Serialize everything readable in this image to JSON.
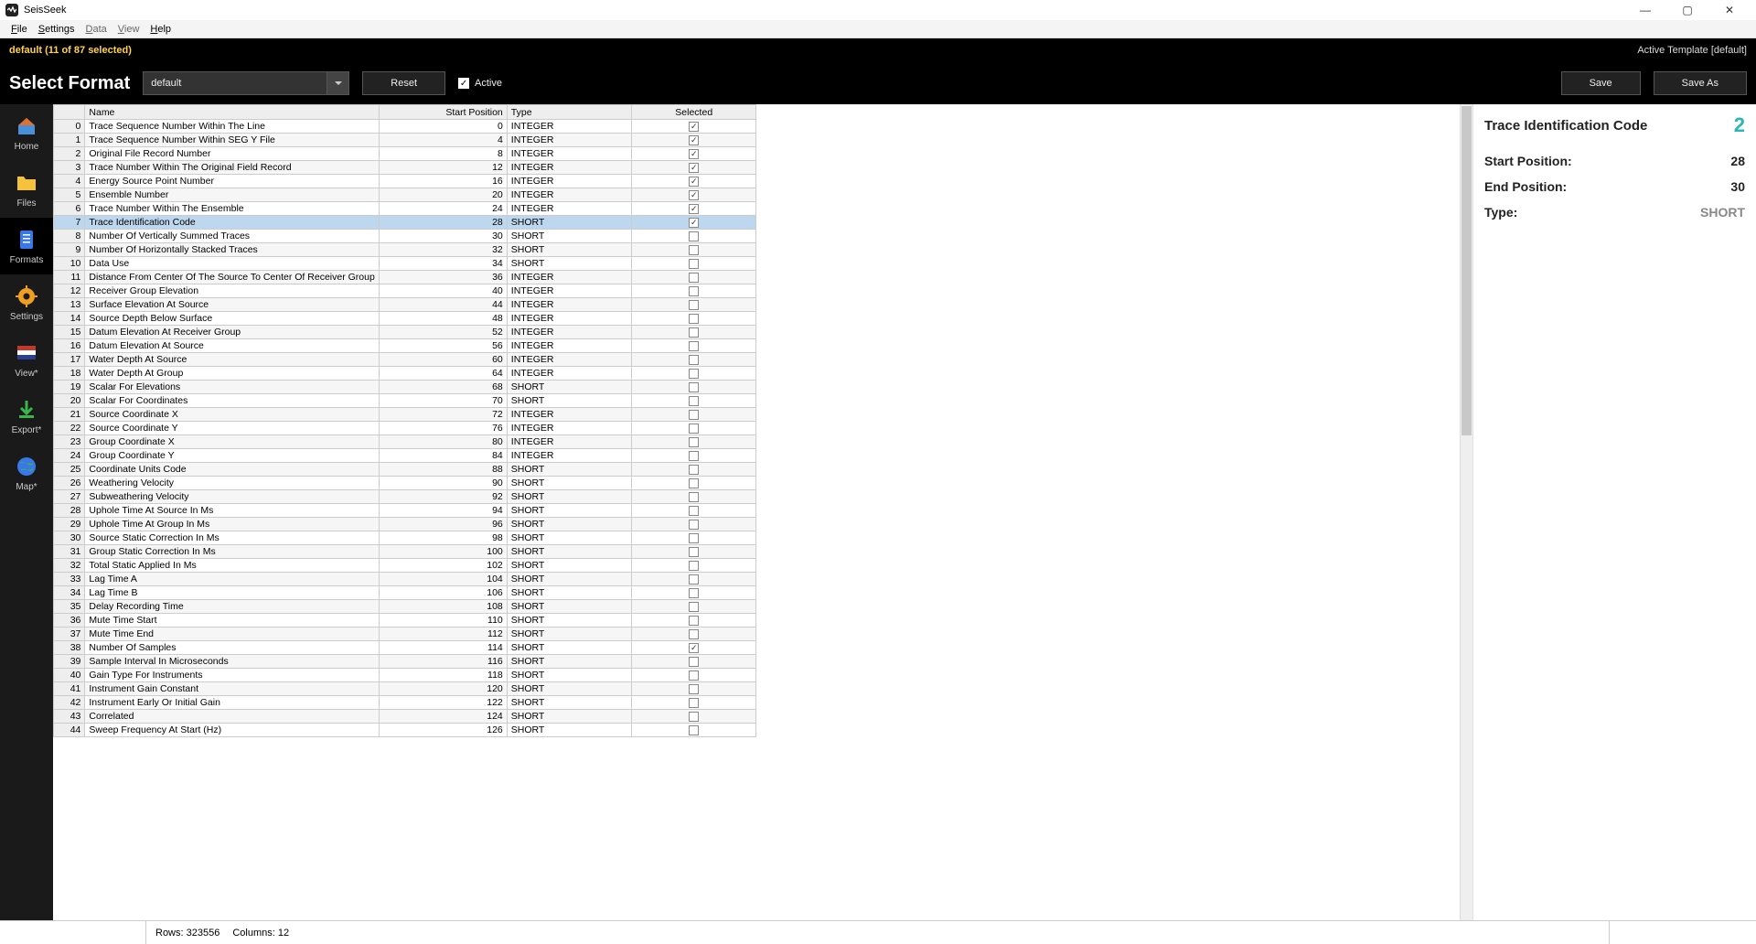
{
  "app_title": "SeisSeek",
  "menu": [
    "File",
    "Settings",
    "Data",
    "View",
    "Help"
  ],
  "menu_enabled": [
    true,
    true,
    false,
    false,
    true
  ],
  "info_left": "default  (11 of 87 selected)",
  "info_right": "Active Template [default]",
  "page_title": "Select Format",
  "template_value": "default",
  "reset_label": "Reset",
  "active_label": "Active",
  "active_checked": true,
  "save_label": "Save",
  "saveas_label": "Save As",
  "sidenav": [
    {
      "label": "Home",
      "icon": "home"
    },
    {
      "label": "Files",
      "icon": "folder"
    },
    {
      "label": "Formats",
      "icon": "doc"
    },
    {
      "label": "Settings",
      "icon": "gear"
    },
    {
      "label": "View*",
      "icon": "flag"
    },
    {
      "label": "Export*",
      "icon": "download"
    },
    {
      "label": "Map*",
      "icon": "globe"
    }
  ],
  "columns": [
    "",
    "Name",
    "Start Position",
    "Type",
    "Selected"
  ],
  "selected_index": 7,
  "rows": [
    {
      "i": 0,
      "name": "Trace Sequence Number Within The Line",
      "start": 0,
      "type": "INTEGER",
      "sel": true
    },
    {
      "i": 1,
      "name": "Trace Sequence Number Within SEG Y File",
      "start": 4,
      "type": "INTEGER",
      "sel": true
    },
    {
      "i": 2,
      "name": "Original File Record Number",
      "start": 8,
      "type": "INTEGER",
      "sel": true
    },
    {
      "i": 3,
      "name": "Trace Number Within The Original Field Record",
      "start": 12,
      "type": "INTEGER",
      "sel": true
    },
    {
      "i": 4,
      "name": "Energy Source Point Number",
      "start": 16,
      "type": "INTEGER",
      "sel": true
    },
    {
      "i": 5,
      "name": "Ensemble Number",
      "start": 20,
      "type": "INTEGER",
      "sel": true
    },
    {
      "i": 6,
      "name": "Trace Number Within The Ensemble",
      "start": 24,
      "type": "INTEGER",
      "sel": true
    },
    {
      "i": 7,
      "name": "Trace Identification Code",
      "start": 28,
      "type": "SHORT",
      "sel": true
    },
    {
      "i": 8,
      "name": "Number Of Vertically Summed Traces",
      "start": 30,
      "type": "SHORT",
      "sel": false
    },
    {
      "i": 9,
      "name": "Number Of Horizontally Stacked Traces",
      "start": 32,
      "type": "SHORT",
      "sel": false
    },
    {
      "i": 10,
      "name": "Data Use",
      "start": 34,
      "type": "SHORT",
      "sel": false
    },
    {
      "i": 11,
      "name": "Distance From Center Of The Source To Center Of Receiver Group",
      "start": 36,
      "type": "INTEGER",
      "sel": false
    },
    {
      "i": 12,
      "name": "Receiver Group Elevation",
      "start": 40,
      "type": "INTEGER",
      "sel": false
    },
    {
      "i": 13,
      "name": "Surface Elevation At Source",
      "start": 44,
      "type": "INTEGER",
      "sel": false
    },
    {
      "i": 14,
      "name": "Source Depth Below Surface",
      "start": 48,
      "type": "INTEGER",
      "sel": false
    },
    {
      "i": 15,
      "name": "Datum Elevation At Receiver Group",
      "start": 52,
      "type": "INTEGER",
      "sel": false
    },
    {
      "i": 16,
      "name": "Datum Elevation At Source",
      "start": 56,
      "type": "INTEGER",
      "sel": false
    },
    {
      "i": 17,
      "name": "Water Depth At Source",
      "start": 60,
      "type": "INTEGER",
      "sel": false
    },
    {
      "i": 18,
      "name": "Water Depth At Group",
      "start": 64,
      "type": "INTEGER",
      "sel": false
    },
    {
      "i": 19,
      "name": "Scalar For Elevations",
      "start": 68,
      "type": "SHORT",
      "sel": false
    },
    {
      "i": 20,
      "name": "Scalar For Coordinates",
      "start": 70,
      "type": "SHORT",
      "sel": false
    },
    {
      "i": 21,
      "name": "Source Coordinate X",
      "start": 72,
      "type": "INTEGER",
      "sel": false
    },
    {
      "i": 22,
      "name": "Source Coordinate Y",
      "start": 76,
      "type": "INTEGER",
      "sel": false
    },
    {
      "i": 23,
      "name": "Group Coordinate X",
      "start": 80,
      "type": "INTEGER",
      "sel": false
    },
    {
      "i": 24,
      "name": "Group Coordinate Y",
      "start": 84,
      "type": "INTEGER",
      "sel": false
    },
    {
      "i": 25,
      "name": "Coordinate Units Code",
      "start": 88,
      "type": "SHORT",
      "sel": false
    },
    {
      "i": 26,
      "name": "Weathering Velocity",
      "start": 90,
      "type": "SHORT",
      "sel": false
    },
    {
      "i": 27,
      "name": "Subweathering Velocity",
      "start": 92,
      "type": "SHORT",
      "sel": false
    },
    {
      "i": 28,
      "name": "Uphole Time At Source In Ms",
      "start": 94,
      "type": "SHORT",
      "sel": false
    },
    {
      "i": 29,
      "name": "Uphole Time At Group In Ms",
      "start": 96,
      "type": "SHORT",
      "sel": false
    },
    {
      "i": 30,
      "name": "Source Static Correction In Ms",
      "start": 98,
      "type": "SHORT",
      "sel": false
    },
    {
      "i": 31,
      "name": "Group Static Correction In Ms",
      "start": 100,
      "type": "SHORT",
      "sel": false
    },
    {
      "i": 32,
      "name": "Total Static Applied In Ms",
      "start": 102,
      "type": "SHORT",
      "sel": false
    },
    {
      "i": 33,
      "name": "Lag Time A",
      "start": 104,
      "type": "SHORT",
      "sel": false
    },
    {
      "i": 34,
      "name": "Lag Time B",
      "start": 106,
      "type": "SHORT",
      "sel": false
    },
    {
      "i": 35,
      "name": "Delay Recording Time",
      "start": 108,
      "type": "SHORT",
      "sel": false
    },
    {
      "i": 36,
      "name": "Mute Time Start",
      "start": 110,
      "type": "SHORT",
      "sel": false
    },
    {
      "i": 37,
      "name": "Mute Time End",
      "start": 112,
      "type": "SHORT",
      "sel": false
    },
    {
      "i": 38,
      "name": "Number Of Samples",
      "start": 114,
      "type": "SHORT",
      "sel": true
    },
    {
      "i": 39,
      "name": "Sample Interval In Microseconds",
      "start": 116,
      "type": "SHORT",
      "sel": false
    },
    {
      "i": 40,
      "name": "Gain Type For Instruments",
      "start": 118,
      "type": "SHORT",
      "sel": false
    },
    {
      "i": 41,
      "name": "Instrument Gain Constant",
      "start": 120,
      "type": "SHORT",
      "sel": false
    },
    {
      "i": 42,
      "name": "Instrument Early Or Initial Gain",
      "start": 122,
      "type": "SHORT",
      "sel": false
    },
    {
      "i": 43,
      "name": "Correlated",
      "start": 124,
      "type": "SHORT",
      "sel": false
    },
    {
      "i": 44,
      "name": "Sweep Frequency At Start (Hz)",
      "start": 126,
      "type": "SHORT",
      "sel": false
    }
  ],
  "detail": {
    "title": "Trace Identification Code",
    "count": "2",
    "start_label": "Start Position:",
    "start_value": "28",
    "end_label": "End Position:",
    "end_value": "30",
    "type_label": "Type:",
    "type_value": "SHORT"
  },
  "status": {
    "rows": "Rows: 323556",
    "cols": "Columns: 12"
  }
}
